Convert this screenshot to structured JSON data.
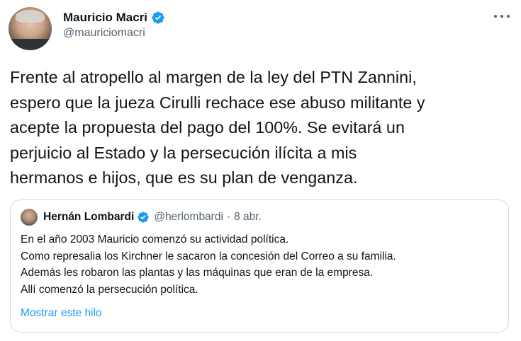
{
  "tweet": {
    "author_name": "Mauricio Macri",
    "author_handle": "@mauriciomacri",
    "text": "Frente al atropello al margen de la ley del PTN Zannini,\nespero que la jueza Cirulli rechace ese abuso militante y\nacepte la propuesta del pago del 100%. Se evitará un\nperjuicio al Estado y la persecución ilícita a mis\nhermanos e hijos, que es su plan de venganza.",
    "more_icon": "more-horizontal-icon",
    "verified_icon": "verified-badge-icon"
  },
  "quoted_tweet": {
    "author_name": "Hernán Lombardi",
    "author_handle": "@herlombardi",
    "separator": "·",
    "date": "8 abr.",
    "lines": [
      "En el año 2003 Mauricio comenzó su actividad política.",
      "Como represalia los Kirchner le sacaron la concesión del Correo a su familia.",
      "Además les robaron las plantas y las máquinas que eran de la empresa.",
      "Allí comenzó la persecución política."
    ],
    "show_thread_label": "Mostrar este hilo"
  },
  "colors": {
    "text_primary": "#0f1419",
    "text_secondary": "#536471",
    "link": "#1d9bf0",
    "verified": "#1d9bf0",
    "border": "#cfd9de"
  }
}
